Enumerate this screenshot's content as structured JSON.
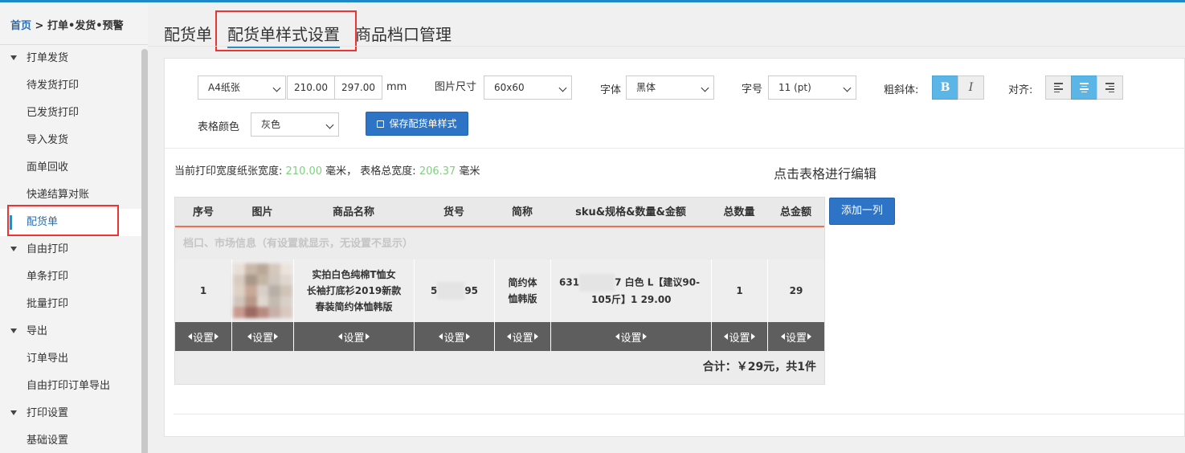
{
  "breadcrumb": {
    "home": "首页",
    "separator": " > ",
    "current": "打单•发货•预警"
  },
  "sidebar": {
    "items": [
      {
        "label": "打单发货",
        "type": "group"
      },
      {
        "label": "待发货打印",
        "type": "sub"
      },
      {
        "label": "已发货打印",
        "type": "sub"
      },
      {
        "label": "导入发货",
        "type": "sub"
      },
      {
        "label": "面单回收",
        "type": "sub"
      },
      {
        "label": "快递结算对账",
        "type": "sub"
      },
      {
        "label": "配货单",
        "type": "sub",
        "active": true
      },
      {
        "label": "自由打印",
        "type": "group"
      },
      {
        "label": "单条打印",
        "type": "sub"
      },
      {
        "label": "批量打印",
        "type": "sub"
      },
      {
        "label": "导出",
        "type": "group"
      },
      {
        "label": "订单导出",
        "type": "sub"
      },
      {
        "label": "自由打印订单导出",
        "type": "sub"
      },
      {
        "label": "打印设置",
        "type": "group"
      },
      {
        "label": "基础设置",
        "type": "sub"
      }
    ]
  },
  "tabs": [
    {
      "label": "配货单"
    },
    {
      "label": "配货单样式设置",
      "active": true
    },
    {
      "label": "商品档口管理"
    }
  ],
  "settings": {
    "paper": "A4纸张",
    "width": "210.00",
    "height": "297.00",
    "unit": "mm",
    "image_size_label": "图片尺寸",
    "image_size": "60x60",
    "font_label": "字体",
    "font": "黑体",
    "font_size_label": "字号",
    "font_size": "11 (pt)",
    "style_label": "粗斜体:",
    "bold": "B",
    "italic": "I",
    "align_label": "对齐:",
    "border_color_label": "表格颜色",
    "border_color": "灰色",
    "save_button": "保存配货单样式"
  },
  "info": {
    "prefix": "当前打印宽度纸张宽度:",
    "paper_width": "210.00",
    "mid": "毫米， 表格总宽度:",
    "table_width": "206.37",
    "suffix": "毫米"
  },
  "edit_hint": "点击表格进行编辑",
  "table": {
    "headers": [
      "序号",
      "图片",
      "商品名称",
      "货号",
      "简称",
      "sku&规格&数量&金额",
      "总数量",
      "总金额"
    ],
    "shop_info": "档口、市场信息（有设置就显示，无设置不显示）",
    "row": {
      "index": "1",
      "name_l1": "实拍白色纯棉T恤女",
      "name_l2": "长袖打底衫2019新款",
      "name_l3": "春装简约体恤韩版",
      "sku_prefix": "5",
      "sku_suffix": "95",
      "short_l1": "简约体",
      "short_l2": "恤韩版",
      "spec_prefix": "631",
      "spec_l1_suffix": "7 白色 L【建议90-",
      "spec_l2": "105斤】1 29.00",
      "qty": "1",
      "amount": "29"
    },
    "setting_label": "设置",
    "total": "合计：￥29元，共1件"
  },
  "add_column_button": "添加一列",
  "colors": {
    "accent": "#2d74c6",
    "highlight_red": "#e33333",
    "green_value": "#7fd07f",
    "header_underline": "#f07050"
  }
}
